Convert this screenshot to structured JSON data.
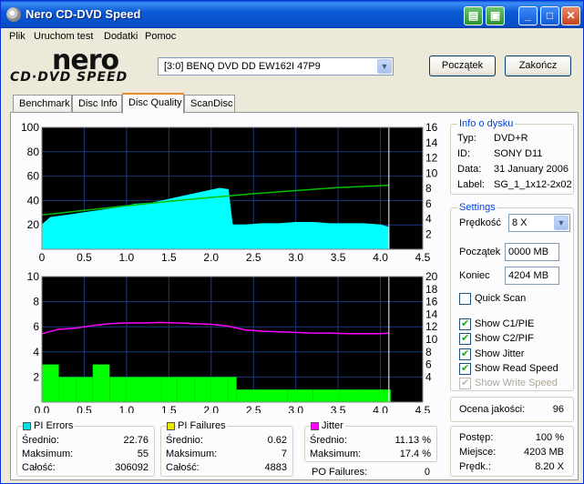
{
  "window": {
    "title": "Nero CD-DVD Speed"
  },
  "menu": [
    "Plik",
    "Uruchom test",
    "Dodatki",
    "Pomoc"
  ],
  "logo": {
    "nero": "nero",
    "cddvd": "CD·DVD SPEED"
  },
  "drive": {
    "selected": "[3:0]  BENQ DVD DD EW162I 47P9"
  },
  "buttons": {
    "start": "Początek",
    "exit": "Zakończ"
  },
  "tabs": [
    "Benchmark",
    "Disc Info",
    "Disc Quality",
    "ScanDisc"
  ],
  "active_tab": "Disc Quality",
  "disc_info": {
    "title": "Info o dysku",
    "rows": [
      {
        "label": "Typ:",
        "value": "DVD+R"
      },
      {
        "label": "ID:",
        "value": "SONY D11"
      },
      {
        "label": "Data:",
        "value": "31 January 2006"
      },
      {
        "label": "Label:",
        "value": "SG_1_1x12-2x02"
      }
    ]
  },
  "settings": {
    "title": "Settings",
    "speed_label": "Prędkość",
    "speed_value": "8 X",
    "start_label": "Początek",
    "start_value": "0000 MB",
    "end_label": "Koniec",
    "end_value": "4204 MB",
    "quick_scan": {
      "label": "Quick Scan",
      "checked": false
    },
    "options": [
      {
        "label": "Show C1/PIE",
        "checked": true,
        "enabled": true
      },
      {
        "label": "Show C2/PIF",
        "checked": true,
        "enabled": true
      },
      {
        "label": "Show Jitter",
        "checked": true,
        "enabled": true
      },
      {
        "label": "Show Read Speed",
        "checked": true,
        "enabled": true
      },
      {
        "label": "Show Write Speed",
        "checked": true,
        "enabled": false
      }
    ]
  },
  "quality": {
    "label": "Ocena jakości:",
    "value": "96"
  },
  "progress": {
    "rows": [
      {
        "label": "Postęp:",
        "value": "100 %"
      },
      {
        "label": "Miejsce:",
        "value": "4203 MB"
      },
      {
        "label": "Prędk.:",
        "value": "8.20 X"
      }
    ]
  },
  "stats": {
    "pi_errors": {
      "title": "PI Errors",
      "color": "#00e0e0",
      "rows": [
        {
          "label": "Średnio:",
          "value": "22.76"
        },
        {
          "label": "Maksimum:",
          "value": "55"
        },
        {
          "label": "Całość:",
          "value": "306092"
        }
      ]
    },
    "pi_failures": {
      "title": "PI Failures",
      "color": "#e8e800",
      "rows": [
        {
          "label": "Średnio:",
          "value": "0.62"
        },
        {
          "label": "Maksimum:",
          "value": "7"
        },
        {
          "label": "Całość:",
          "value": "4883"
        }
      ]
    },
    "jitter": {
      "title": "Jitter",
      "color": "#ff00ff",
      "rows": [
        {
          "label": "Średnio:",
          "value": "11.13 %"
        },
        {
          "label": "Maksimum:",
          "value": "17.4 %"
        }
      ]
    },
    "po_failures": {
      "label": "PO Failures:",
      "value": "0"
    }
  },
  "colors": {
    "plot_bg": "#000000",
    "grid": "#1a3a80",
    "pie": "#00ffff",
    "pif": "#00ff00",
    "jitter": "#ff00ff",
    "read_speed": "#00c000",
    "end_marker": "#ffffff"
  },
  "chart_data": [
    {
      "type": "area",
      "xlabel": "",
      "ylabel": "",
      "xlim": [
        0,
        4.5
      ],
      "ylim": [
        0,
        100
      ],
      "y2lim": [
        0,
        16
      ],
      "xticks": [
        "0",
        "0.5",
        "1.0",
        "1.5",
        "2.0",
        "2.5",
        "3.0",
        "3.5",
        "4.0",
        "4.5"
      ],
      "yticks": [
        "20",
        "40",
        "60",
        "80",
        "100"
      ],
      "y2ticks": [
        "2",
        "4",
        "6",
        "8",
        "10",
        "12",
        "14",
        "16"
      ],
      "end_x": 4.1,
      "series": [
        {
          "key": "pie",
          "x": [
            0,
            0.1,
            0.3,
            0.5,
            0.7,
            0.9,
            1.1,
            1.3,
            1.5,
            1.7,
            1.9,
            2.1,
            2.2,
            2.25,
            2.4,
            2.6,
            2.8,
            3.0,
            3.2,
            3.4,
            3.6,
            3.8,
            4.0,
            4.1
          ],
          "y": [
            20,
            26,
            28,
            30,
            32,
            34,
            37,
            38,
            41,
            44,
            47,
            50,
            49,
            20,
            20,
            21,
            21,
            22,
            22,
            21,
            21,
            21,
            20,
            18
          ]
        },
        {
          "key": "read_speed",
          "x": [
            0,
            0.5,
            1.0,
            1.5,
            2.0,
            2.5,
            3.0,
            3.5,
            4.1
          ],
          "y": [
            4.5,
            5.1,
            5.7,
            6.3,
            6.8,
            7.3,
            7.7,
            8.1,
            8.4
          ]
        }
      ]
    },
    {
      "type": "bar",
      "xlabel": "",
      "ylabel": "",
      "xlim": [
        0,
        4.5
      ],
      "ylim": [
        0,
        10
      ],
      "y2lim": [
        0,
        20
      ],
      "xticks": [
        "0.0",
        "0.5",
        "1.0",
        "1.5",
        "2.0",
        "2.5",
        "3.0",
        "3.5",
        "4.0",
        "4.5"
      ],
      "yticks": [
        "2",
        "4",
        "6",
        "8",
        "10"
      ],
      "y2ticks": [
        "4",
        "6",
        "8",
        "10",
        "12",
        "14",
        "16",
        "18",
        "20"
      ],
      "end_x": 4.1,
      "series": [
        {
          "key": "pif",
          "x": [
            0,
            0.2,
            0.4,
            0.6,
            0.8,
            1.0,
            1.2,
            1.4,
            1.6,
            1.8,
            2.0,
            2.2,
            2.3,
            2.6,
            2.9,
            3.2,
            3.5,
            3.8,
            4.1
          ],
          "y": [
            3,
            2,
            2,
            3,
            2,
            2,
            2,
            2,
            2,
            2,
            2,
            2,
            1,
            1,
            1,
            1,
            1,
            1,
            1
          ]
        },
        {
          "key": "jitter",
          "x": [
            0,
            0.2,
            0.4,
            0.6,
            0.8,
            1.0,
            1.2,
            1.4,
            1.6,
            1.8,
            2.0,
            2.2,
            2.4,
            2.6,
            2.8,
            3.0,
            3.2,
            3.4,
            3.6,
            3.8,
            4.0,
            4.1
          ],
          "y": [
            10.9,
            11.6,
            11.8,
            12.2,
            12.5,
            12.6,
            12.6,
            12.7,
            12.6,
            12.5,
            12.4,
            12.1,
            11.5,
            11.3,
            11.2,
            11.1,
            11.0,
            11.0,
            10.9,
            10.9,
            10.9,
            11.0
          ]
        }
      ]
    }
  ]
}
